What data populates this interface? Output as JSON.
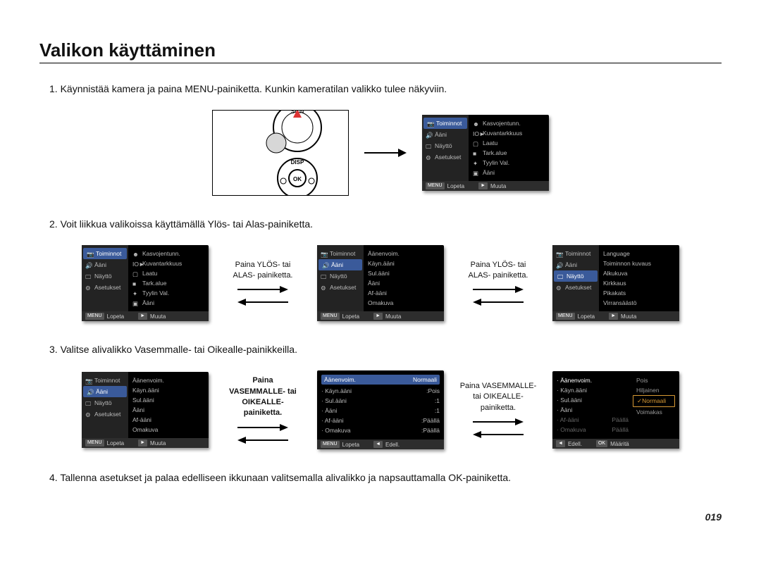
{
  "title": "Valikon käyttäminen",
  "step1": "1. Käynnistää kamera ja paina MENU-painiketta.  Kunkin kameratilan valikko tulee näkyviin.",
  "step2": "2. Voit liikkua valikoissa käyttämällä Ylös- tai Alas-painiketta.",
  "step3": "3. Valitse alivalikko Vasemmalle- tai Oikealle-painikkeilla.",
  "step4": "4. Tallenna asetukset ja palaa edelliseen ikkunaan valitsemalla alivalikko ja napsauttamalla OK-painiketta.",
  "page_num": "019",
  "captions": {
    "ylos": "Paina YLÖS- tai ALAS- painiketta.",
    "vasen": "Paina VASEMMALLE- tai OIKEALLE- painiketta."
  },
  "tabs_main": [
    "Toiminnot",
    "Ääni",
    "Näyttö",
    "Asetukset"
  ],
  "footer": {
    "menu": "MENU",
    "lopeta": "Lopeta",
    "play": "►",
    "muuta": "Muuta",
    "back": "◄",
    "edell": "Edell.",
    "ok": "OK",
    "maarita": "Määritä"
  },
  "screen1_right": [
    "Kasvojentunn.",
    "Kuvantarkkuus",
    "Laatu",
    "Tark.alue",
    "Tyylin Val.",
    "Ääni"
  ],
  "screen2c_right": [
    "Äänenvoim.",
    "Käyn.ääni",
    "Sul.ääni",
    "Ääni",
    "Af-ääni",
    "Omakuva"
  ],
  "screen2d_right": [
    "Language",
    "Toiminnon kuvaus",
    "Alkukuva",
    "Kirkkaus",
    "Pikakats",
    "Virransäästö"
  ],
  "screen3a_right": [
    {
      "l": "Äänenvoim.",
      "v": ""
    },
    {
      "l": "Käyn.ääni",
      "v": ""
    },
    {
      "l": "Sul.ääni",
      "v": ""
    },
    {
      "l": "Ääni",
      "v": ""
    },
    {
      "l": "Af-ääni",
      "v": ""
    },
    {
      "l": "Omakuva",
      "v": ""
    }
  ],
  "screen3b_right": [
    {
      "l": "Äänenvoim.",
      "v": "Normaali"
    },
    {
      "l": "Käyn.ääni",
      "v": "Pois"
    },
    {
      "l": "Sul.ääni",
      "v": "1"
    },
    {
      "l": "Ääni",
      "v": "1"
    },
    {
      "l": "Af-ääni",
      "v": "Päällä"
    },
    {
      "l": "Omakuva",
      "v": "Päällä"
    }
  ],
  "screen3c_left": [
    "Äänenvoim.",
    "Käyn.ääni",
    "Sul.ääni",
    "Ääni",
    "Af-ääni",
    "Omakuva"
  ],
  "screen3c_opts": [
    "Pois",
    "Hiljainen",
    "Normaali",
    "Voimakas"
  ],
  "screen3c_faded": [
    "Päällä",
    "Päällä"
  ],
  "ricon_markers": [
    "IO►",
    "□",
    "■",
    "⚙",
    "▣"
  ]
}
